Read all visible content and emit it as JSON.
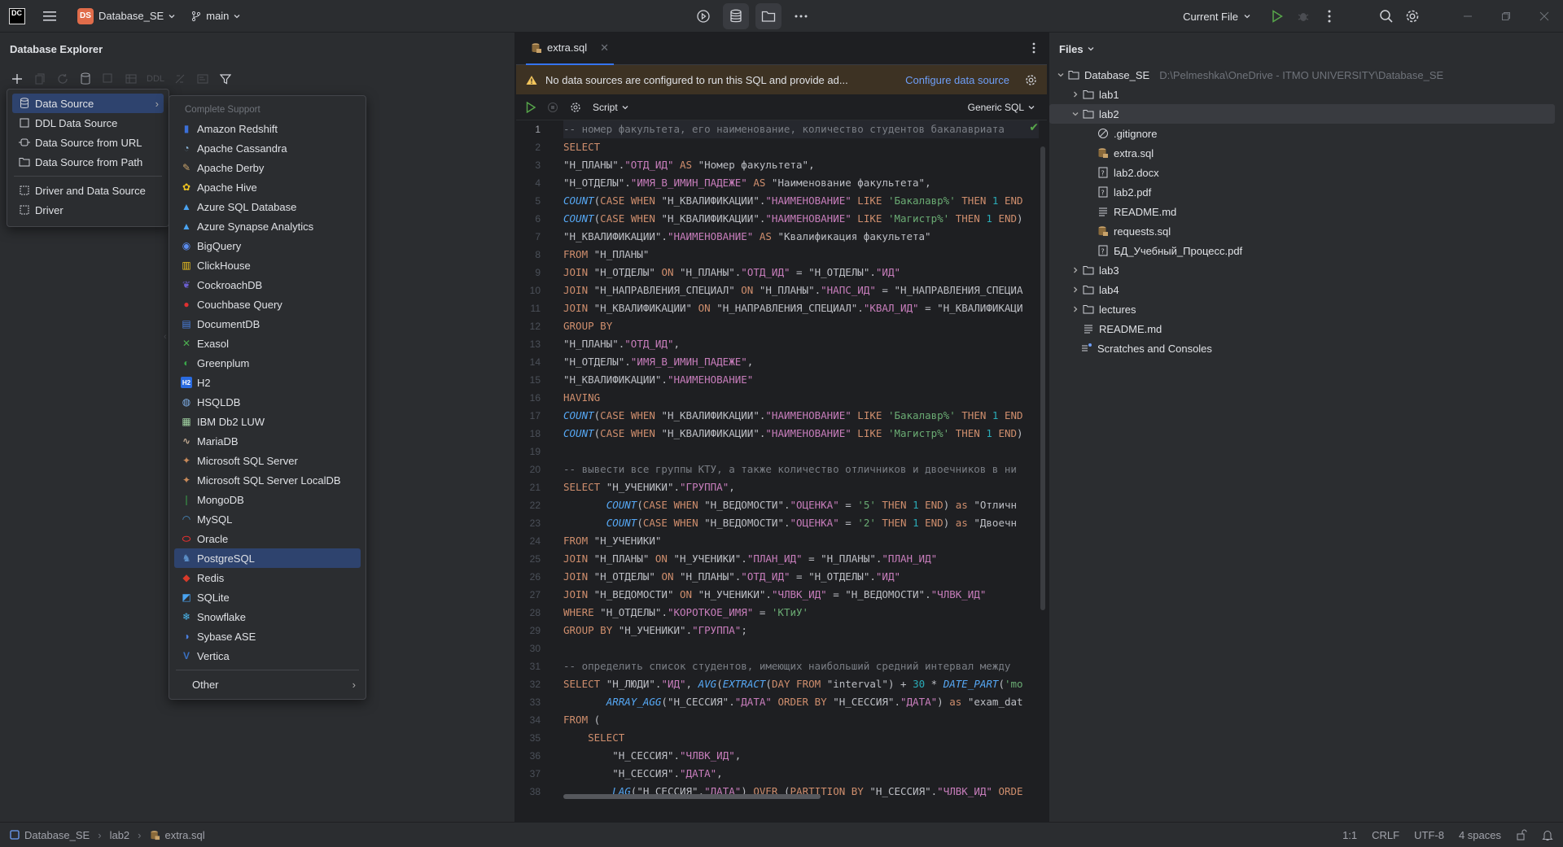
{
  "titlebar": {
    "app_logo": "DC",
    "project_badge": "DS",
    "project_name": "Database_SE",
    "branch": "main",
    "run_config": "Current File"
  },
  "left_panel": {
    "title": "Database Explorer",
    "ddl_label": "DDL",
    "menu1": [
      {
        "label": "Data Source",
        "icon": "database-icon",
        "selected": true,
        "submenu": true
      },
      {
        "label": "DDL Data Source",
        "icon": "ddl-icon"
      },
      {
        "label": "Data Source from URL",
        "icon": "url-icon"
      },
      {
        "label": "Data Source from Path",
        "icon": "folder-icon"
      },
      {
        "label": "Driver and Data Source",
        "icon": "driver-datasource-icon",
        "separator_before": true
      },
      {
        "label": "Driver",
        "icon": "driver-icon"
      }
    ],
    "menu2_header": "Complete Support",
    "menu2": [
      {
        "label": "Amazon Redshift",
        "icon": "amazon-redshift-icon",
        "color": "#3b6fd8",
        "glyph": "▮"
      },
      {
        "label": "Apache Cassandra",
        "icon": "cassandra-icon",
        "color": "#8ab4d8",
        "glyph": "◔"
      },
      {
        "label": "Apache Derby",
        "icon": "derby-icon",
        "color": "#c9a36b",
        "glyph": "✎"
      },
      {
        "label": "Apache Hive",
        "icon": "hive-icon",
        "color": "#f0c420",
        "glyph": "✿"
      },
      {
        "label": "Azure SQL Database",
        "icon": "azure-icon",
        "color": "#4aa3f0",
        "glyph": "▲"
      },
      {
        "label": "Azure Synapse Analytics",
        "icon": "azure-synapse-icon",
        "color": "#4aa3f0",
        "glyph": "▲"
      },
      {
        "label": "BigQuery",
        "icon": "bigquery-icon",
        "color": "#5b8df0",
        "glyph": "◉"
      },
      {
        "label": "ClickHouse",
        "icon": "clickhouse-icon",
        "color": "#f0c420",
        "glyph": "▥"
      },
      {
        "label": "CockroachDB",
        "icon": "cockroachdb-icon",
        "color": "#6b5fd0",
        "glyph": "❦"
      },
      {
        "label": "Couchbase Query",
        "icon": "couchbase-icon",
        "color": "#e03030",
        "glyph": "●"
      },
      {
        "label": "DocumentDB",
        "icon": "documentdb-icon",
        "color": "#4a7fe0",
        "glyph": "▤"
      },
      {
        "label": "Exasol",
        "icon": "exasol-icon",
        "color": "#4caf50",
        "glyph": "✕"
      },
      {
        "label": "Greenplum",
        "icon": "greenplum-icon",
        "color": "#3aa84a",
        "glyph": "◐"
      },
      {
        "label": "H2",
        "icon": "h2-icon",
        "color": "#2a6be0",
        "glyph": "H2"
      },
      {
        "label": "HSQLDB",
        "icon": "hsqldb-icon",
        "color": "#7fb0e8",
        "glyph": "◍"
      },
      {
        "label": "IBM Db2 LUW",
        "icon": "ibm-db2-icon",
        "color": "#9fd0a0",
        "glyph": "▦"
      },
      {
        "label": "MariaDB",
        "icon": "mariadb-icon",
        "color": "#c0a890",
        "glyph": "∿"
      },
      {
        "label": "Microsoft SQL Server",
        "icon": "sql-server-icon",
        "color": "#c98a5a",
        "glyph": "✦"
      },
      {
        "label": "Microsoft SQL Server LocalDB",
        "icon": "sql-server-localdb-icon",
        "color": "#c98a5a",
        "glyph": "✦"
      },
      {
        "label": "MongoDB",
        "icon": "mongodb-icon",
        "color": "#3aa84a",
        "glyph": "❘"
      },
      {
        "label": "MySQL",
        "icon": "mysql-icon",
        "color": "#4a90c8",
        "glyph": "◠"
      },
      {
        "label": "Oracle",
        "icon": "oracle-icon",
        "color": "#e03030",
        "glyph": "⬭"
      },
      {
        "label": "PostgreSQL",
        "icon": "postgresql-icon",
        "color": "#5b8fc8",
        "glyph": "♞",
        "selected": true
      },
      {
        "label": "Redis",
        "icon": "redis-icon",
        "color": "#d83a2a",
        "glyph": "◆"
      },
      {
        "label": "SQLite",
        "icon": "sqlite-icon",
        "color": "#4aa3f0",
        "glyph": "◩"
      },
      {
        "label": "Snowflake",
        "icon": "snowflake-icon",
        "color": "#4ab8f0",
        "glyph": "❄"
      },
      {
        "label": "Sybase ASE",
        "icon": "sybase-icon",
        "color": "#4a7fe0",
        "glyph": "◑"
      },
      {
        "label": "Vertica",
        "icon": "vertica-icon",
        "color": "#3a70c0",
        "glyph": "V"
      }
    ],
    "menu2_other": "Other"
  },
  "editor": {
    "tab_name": "extra.sql",
    "warning": "No data sources are configured to run this SQL and provide ad...",
    "configure_link": "Configure data source",
    "script_label": "Script",
    "dialect_label": "Generic SQL",
    "lines": [
      "-- номер факультета, его наименование, количество студентов бакалавриата",
      "SELECT",
      "\"Н_ПЛАНЫ\".\"ОТД_ИД\" AS \"Номер факультета\",",
      "\"Н_ОТДЕЛЫ\".\"ИМЯ_В_ИМИН_ПАДЕЖЕ\" AS \"Наименование факультета\",",
      "COUNT(CASE WHEN \"Н_КВАЛИФИКАЦИИ\".\"НАИМЕНОВАНИЕ\" LIKE 'Бакалавр%' THEN 1 END",
      "COUNT(CASE WHEN \"Н_КВАЛИФИКАЦИИ\".\"НАИМЕНОВАНИЕ\" LIKE 'Магистр%' THEN 1 END)",
      "\"Н_КВАЛИФИКАЦИИ\".\"НАИМЕНОВАНИЕ\" AS \"Квалификация факультета\"",
      "FROM \"Н_ПЛАНЫ\"",
      "JOIN \"Н_ОТДЕЛЫ\" ON \"Н_ПЛАНЫ\".\"ОТД_ИД\" = \"Н_ОТДЕЛЫ\".\"ИД\"",
      "JOIN \"Н_НАПРАВЛЕНИЯ_СПЕЦИАЛ\" ON \"Н_ПЛАНЫ\".\"НАПС_ИД\" = \"Н_НАПРАВЛЕНИЯ_СПЕЦИА",
      "JOIN \"Н_КВАЛИФИКАЦИИ\" ON \"Н_НАПРАВЛЕНИЯ_СПЕЦИАЛ\".\"КВАЛ_ИД\" = \"Н_КВАЛИФИКАЦИ",
      "GROUP BY",
      "\"Н_ПЛАНЫ\".\"ОТД_ИД\",",
      "\"Н_ОТДЕЛЫ\".\"ИМЯ_В_ИМИН_ПАДЕЖЕ\",",
      "\"Н_КВАЛИФИКАЦИИ\".\"НАИМЕНОВАНИЕ\"",
      "HAVING",
      "COUNT(CASE WHEN \"Н_КВАЛИФИКАЦИИ\".\"НАИМЕНОВАНИЕ\" LIKE 'Бакалавр%' THEN 1 END",
      "COUNT(CASE WHEN \"Н_КВАЛИФИКАЦИИ\".\"НАИМЕНОВАНИЕ\" LIKE 'Магистр%' THEN 1 END)",
      "",
      "-- вывести все группы КТУ, а также количество отличников и двоечников в ни",
      "SELECT \"Н_УЧЕНИКИ\".\"ГРУППА\",",
      "       COUNT(CASE WHEN \"Н_ВЕДОМОСТИ\".\"ОЦЕНКА\" = '5' THEN 1 END) as \"Отличн",
      "       COUNT(CASE WHEN \"Н_ВЕДОМОСТИ\".\"ОЦЕНКА\" = '2' THEN 1 END) as \"Двоечн",
      "FROM \"Н_УЧЕНИКИ\"",
      "JOIN \"Н_ПЛАНЫ\" ON \"Н_УЧЕНИКИ\".\"ПЛАН_ИД\" = \"Н_ПЛАНЫ\".\"ПЛАН_ИД\"",
      "JOIN \"Н_ОТДЕЛЫ\" ON \"Н_ПЛАНЫ\".\"ОТД_ИД\" = \"Н_ОТДЕЛЫ\".\"ИД\"",
      "JOIN \"Н_ВЕДОМОСТИ\" ON \"Н_УЧЕНИКИ\".\"ЧЛВК_ИД\" = \"Н_ВЕДОМОСТИ\".\"ЧЛВК_ИД\"",
      "WHERE \"Н_ОТДЕЛЫ\".\"КОРОТКОЕ_ИМЯ\" = 'КТиУ'",
      "GROUP BY \"Н_УЧЕНИКИ\".\"ГРУППА\";",
      "",
      "-- определить список студентов, имеющих наибольший средний интервал между",
      "SELECT \"Н_ЛЮДИ\".\"ИД\", AVG(EXTRACT(DAY FROM \"interval\") + 30 * DATE_PART('mo",
      "       ARRAY_AGG(\"Н_СЕССИЯ\".\"ДАТА\" ORDER BY \"Н_СЕССИЯ\".\"ДАТА\") as \"exam_dat",
      "FROM (",
      "    SELECT",
      "        \"Н_СЕССИЯ\".\"ЧЛВК_ИД\",",
      "        \"Н_СЕССИЯ\".\"ДАТА\",",
      "        LAG(\"Н_СЕССИЯ\".\"ДАТА\") OVER (PARTITION BY \"Н_СЕССИЯ\".\"ЧЛВК_ИД\" ORDE"
    ]
  },
  "files": {
    "title": "Files",
    "tree": [
      {
        "label": "Database_SE",
        "path": "D:\\Pelmeshka\\OneDrive - ITMO UNIVERSITY\\Database_SE",
        "type": "folder",
        "level": 0,
        "expanded": true
      },
      {
        "label": "lab1",
        "type": "folder",
        "level": 1,
        "expanded": false
      },
      {
        "label": "lab2",
        "type": "folder",
        "level": 1,
        "expanded": true,
        "selected": true
      },
      {
        "label": ".gitignore",
        "type": "ignore",
        "level": 2
      },
      {
        "label": "extra.sql",
        "type": "sql",
        "level": 2
      },
      {
        "label": "lab2.docx",
        "type": "unknown",
        "level": 2
      },
      {
        "label": "lab2.pdf",
        "type": "unknown",
        "level": 2
      },
      {
        "label": "README.md",
        "type": "text",
        "level": 2
      },
      {
        "label": "requests.sql",
        "type": "sql",
        "level": 2
      },
      {
        "label": "БД_Учебный_Процесс.pdf",
        "type": "unknown",
        "level": 2
      },
      {
        "label": "lab3",
        "type": "folder",
        "level": 1,
        "expanded": false
      },
      {
        "label": "lab4",
        "type": "folder",
        "level": 1,
        "expanded": false
      },
      {
        "label": "lectures",
        "type": "folder",
        "level": 1,
        "expanded": false
      },
      {
        "label": "README.md",
        "type": "text",
        "level": 1
      },
      {
        "label": "Scratches and Consoles",
        "type": "scratches",
        "level": 0
      }
    ]
  },
  "statusbar": {
    "crumbs": [
      "Database_SE",
      "lab2",
      "extra.sql"
    ],
    "position": "1:1",
    "line_sep": "CRLF",
    "encoding": "UTF-8",
    "indent": "4 spaces"
  },
  "colors": {
    "keyword": "#cf8e6d",
    "function": "#56a8f5",
    "string_quoted_ident": "#c77dbb",
    "string": "#6aab73",
    "number": "#2aacb8",
    "comment": "#7a7e85",
    "selection": "#2e436e",
    "accent": "#3574f0"
  }
}
